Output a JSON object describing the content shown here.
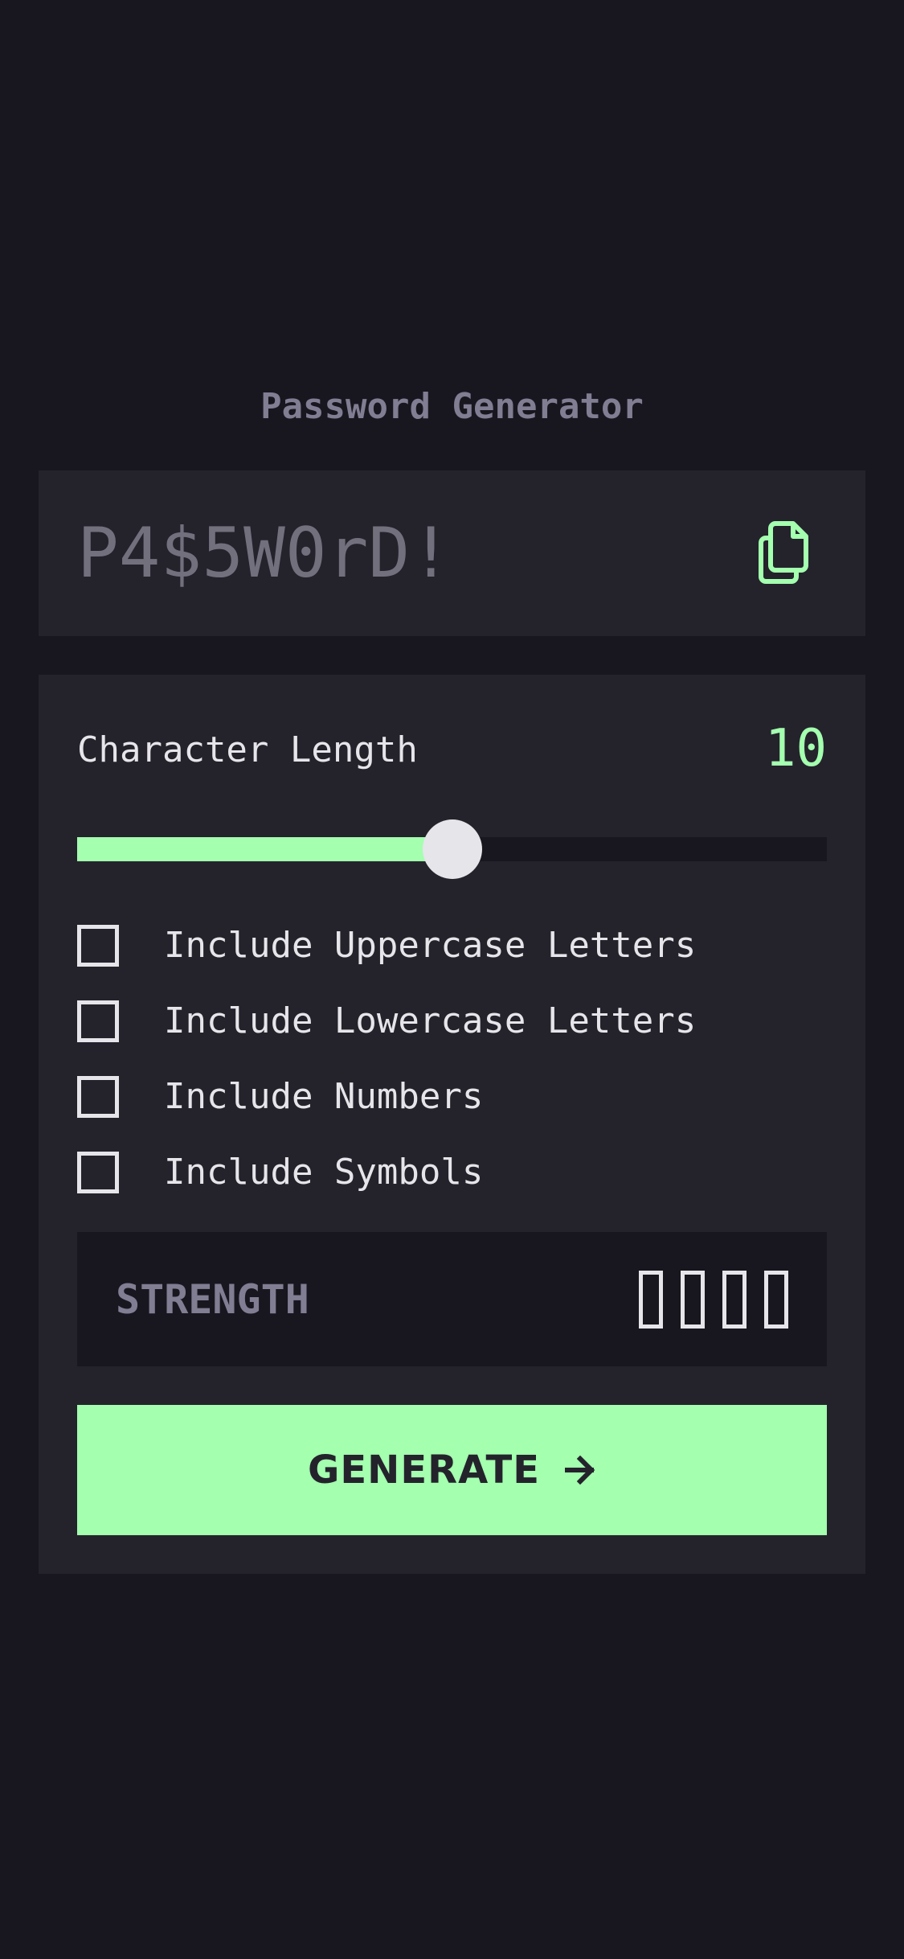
{
  "app": {
    "title": "Password Generator"
  },
  "password": {
    "value": "P4$5W0rD!",
    "copy_icon": "copy-icon"
  },
  "length": {
    "label": "Character Length",
    "value": "10",
    "slider_fraction": 0.5
  },
  "options": [
    {
      "label": "Include Uppercase Letters",
      "checked": false
    },
    {
      "label": "Include Lowercase Letters",
      "checked": false
    },
    {
      "label": "Include Numbers",
      "checked": false
    },
    {
      "label": "Include Symbols",
      "checked": false
    }
  ],
  "strength": {
    "label": "STRENGTH",
    "level": "",
    "bars_filled": 0,
    "bars_total": 4
  },
  "generate": {
    "label": "GENERATE",
    "icon": "arrow-right-icon"
  },
  "colors": {
    "background": "#18171f",
    "panel": "#24232c",
    "accent": "#a4ffaf",
    "text": "#e6e5ea",
    "muted": "#817d92"
  }
}
